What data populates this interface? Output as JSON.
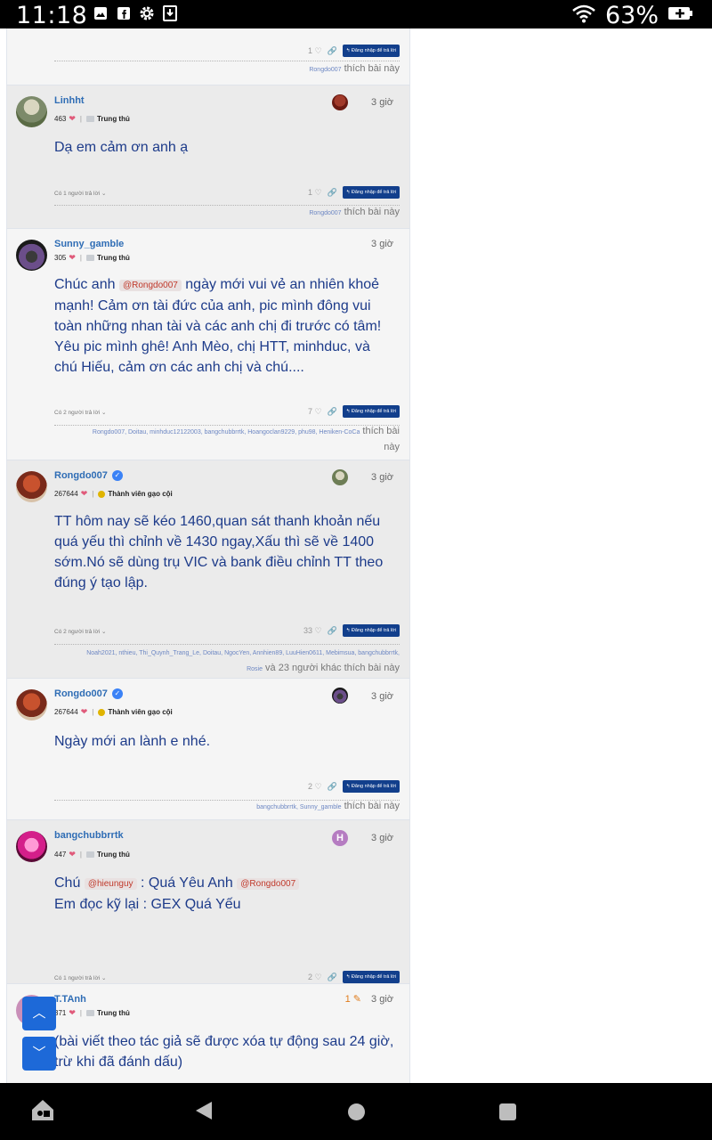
{
  "status_bar": {
    "time": "11:18",
    "battery": "63%"
  },
  "ui": {
    "login_reply": "Đăng nhập để trả lời",
    "like_this": "thích bài này",
    "heart": "❤"
  },
  "posts": [
    {
      "likes": "1",
      "liked_by": "Rongdo007"
    },
    {
      "username": "Linhht",
      "score": "463",
      "rank": "Trung thủ",
      "time": "3 giờ",
      "body": "Dạ em cảm ơn anh ạ",
      "replies": "Có 1 người trả lời",
      "likes": "1",
      "liked_by": "Rongdo007"
    },
    {
      "username": "Sunny_gamble",
      "score": "305",
      "rank": "Trung thủ",
      "time": "3 giờ",
      "body_1": "Chúc anh",
      "mention": "@Rongdo007",
      "body_2": "ngày mới vui vẻ an nhiên khoẻ mạnh! Cảm ơn tài đức của anh, pic mình đông vui toàn những nhan tài và các anh chị đi trước có tâm! Yêu pic mình ghê! Anh Mèo, chị HTT, minhduc, và chú Hiếu, cảm ơn các anh chị và chú....",
      "replies": "Có 2 người trả lời",
      "likes": "7",
      "liked_by": "Rongdo007, Doitau, minhduc12122003, bangchubbrrtk, Hoangoclan9229, phu98, Heniken-CoCa",
      "like_1": "thích bài",
      "like_2": "này"
    },
    {
      "username": "Rongdo007",
      "score": "267644",
      "rank": "Thành viên gạo cội",
      "time": "3 giờ",
      "body": "TT hôm nay sẽ kéo 1460,quan sát thanh khoản nếu quá yếu thì chỉnh về 1430 ngay,Xấu thì sẽ về 1400 sớm.Nó sẽ dùng trụ VIC và bank điều chỉnh TT theo đúng ý tạo lập.",
      "replies": "Có 2 người trả lời",
      "likes": "33",
      "liked_by_1": "Noah2021, nthieu, Thi_Quynh_Trang_Le, Doitau, NgocYen, Annhien89, LuuHien0611, Mebimsua, bangchubbrrtk,",
      "liked_by_2": "Rosie",
      "others": "và 23 người khác"
    },
    {
      "username": "Rongdo007",
      "score": "267644",
      "rank": "Thành viên gạo cội",
      "time": "3 giờ",
      "body": "Ngày mới an lành e nhé.",
      "likes": "2",
      "liked_by": "bangchubbrrtk, Sunny_gamble"
    },
    {
      "username": "bangchubbrrtk",
      "score": "447",
      "rank": "Trung thủ",
      "time": "3 giờ",
      "mini_avatar": "H",
      "body_1": "Chú",
      "mention_1": "@hieunguy",
      "body_2": ": Quá Yêu Anh",
      "mention_2": "@Rongdo007",
      "body_3": "Em đọc kỹ lại : GEX Quá Yếu",
      "replies": "Có 1 người trả lời",
      "likes": "2",
      "liked_by": "Rongdo007, Heniken-CoCa"
    },
    {
      "username": "T.TAnh",
      "score": "371",
      "rank": "Trung thủ",
      "time": "3 giờ",
      "edits": "1",
      "body": "(bài viết theo tác giả sẽ được xóa tự động sau 24 giờ, trừ khi đã đánh dấu)"
    }
  ],
  "colors": {
    "accent": "#123f8c",
    "link": "#2f6db5",
    "body_text": "#1d3b8a",
    "fab": "#1d69d8"
  }
}
